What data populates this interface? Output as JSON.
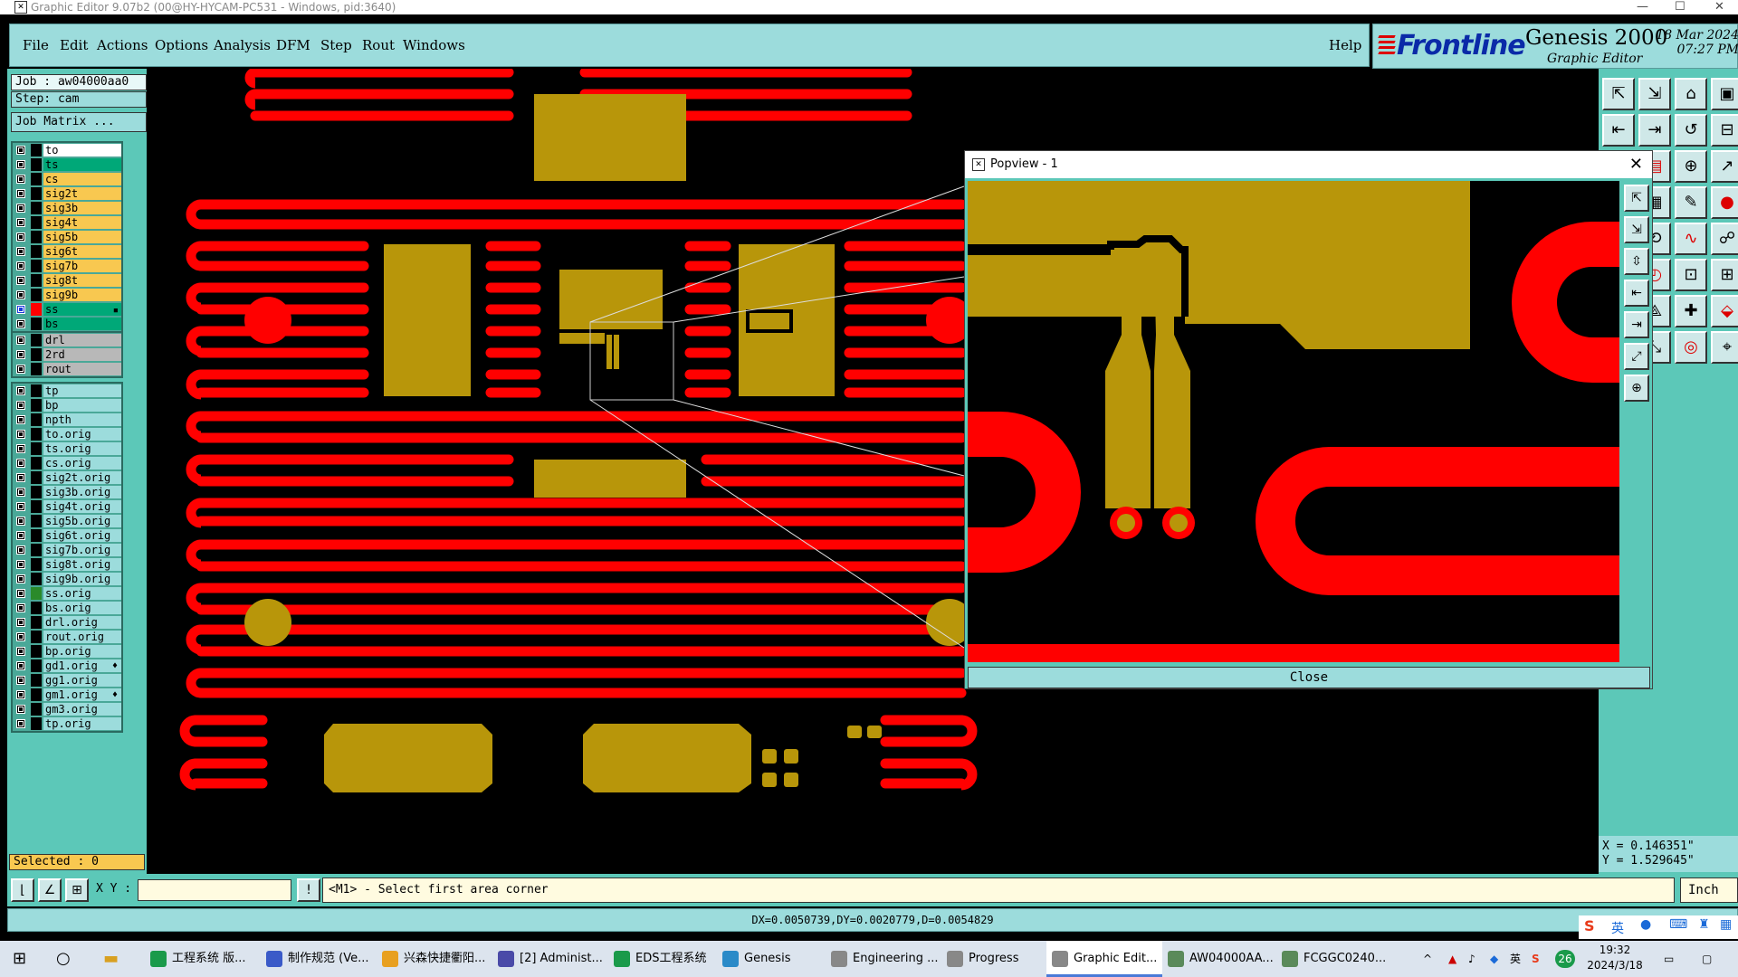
{
  "window": {
    "title": "Graphic Editor 9.07b2 (00@HY-HYCAM-PC531 - Windows, pid:3640)"
  },
  "menu": [
    "File",
    "Edit",
    "Actions",
    "Options",
    "Analysis",
    "DFM",
    "Step",
    "Rout",
    "Windows"
  ],
  "help": "Help",
  "brand": {
    "logo": "Frontline",
    "product": "Genesis 2000",
    "subtitle": "Graphic Editor",
    "date": "18 Mar 2024",
    "time": "07:27 PM"
  },
  "job": {
    "job": "Job : aw04000aa0",
    "step": "Step: cam",
    "matrix": "Job Matrix ..."
  },
  "layers_group1": [
    {
      "name": "to",
      "color": "#ffffff"
    },
    {
      "name": "ts",
      "color": "#00a878"
    },
    {
      "name": "cs",
      "color": "#f8c850"
    },
    {
      "name": "sig2t",
      "color": "#f8c850"
    },
    {
      "name": "sig3b",
      "color": "#f8c850"
    },
    {
      "name": "sig4t",
      "color": "#f8c850"
    },
    {
      "name": "sig5b",
      "color": "#f8c850"
    },
    {
      "name": "sig6t",
      "color": "#f8c850"
    },
    {
      "name": "sig7b",
      "color": "#f8c850"
    },
    {
      "name": "sig8t",
      "color": "#f8c850"
    },
    {
      "name": "sig9b",
      "color": "#f8c850"
    },
    {
      "name": "ss",
      "color": "#00a878",
      "active": true
    },
    {
      "name": "bs",
      "color": "#00a878"
    }
  ],
  "layers_group2": [
    {
      "name": "drl",
      "color": "#b8b8b8"
    },
    {
      "name": "2rd",
      "color": "#b8b8b8"
    },
    {
      "name": "rout",
      "color": "#b8b8b8"
    }
  ],
  "layers_group3": [
    {
      "name": "tp",
      "color": "#9cdcdc"
    },
    {
      "name": "bp",
      "color": "#9cdcdc"
    },
    {
      "name": "npth",
      "color": "#9cdcdc"
    },
    {
      "name": "to.orig",
      "color": "#9cdcdc"
    },
    {
      "name": "ts.orig",
      "color": "#9cdcdc"
    },
    {
      "name": "cs.orig",
      "color": "#9cdcdc"
    },
    {
      "name": "sig2t.orig",
      "color": "#9cdcdc"
    },
    {
      "name": "sig3b.orig",
      "color": "#9cdcdc"
    },
    {
      "name": "sig4t.orig",
      "color": "#9cdcdc"
    },
    {
      "name": "sig5b.orig",
      "color": "#9cdcdc"
    },
    {
      "name": "sig6t.orig",
      "color": "#9cdcdc"
    },
    {
      "name": "sig7b.orig",
      "color": "#9cdcdc"
    },
    {
      "name": "sig8t.orig",
      "color": "#9cdcdc"
    },
    {
      "name": "sig9b.orig",
      "color": "#9cdcdc"
    },
    {
      "name": "ss.orig",
      "color": "#9cdcdc",
      "swatch": "#2a8a2a"
    },
    {
      "name": "bs.orig",
      "color": "#9cdcdc"
    },
    {
      "name": "drl.orig",
      "color": "#9cdcdc"
    },
    {
      "name": "rout.orig",
      "color": "#9cdcdc"
    },
    {
      "name": "bp.orig",
      "color": "#9cdcdc"
    },
    {
      "name": "gd1.orig",
      "color": "#9cdcdc",
      "mark": "♦"
    },
    {
      "name": "gg1.orig",
      "color": "#9cdcdc"
    },
    {
      "name": "gm1.orig",
      "color": "#9cdcdc",
      "mark": "♦"
    },
    {
      "name": "gm3.orig",
      "color": "#9cdcdc"
    },
    {
      "name": "tp.orig",
      "color": "#9cdcdc"
    }
  ],
  "selected": "Selected : 0",
  "coords": {
    "x": "X = 0.146351\"",
    "y": "Y = 1.529645\""
  },
  "cmd": {
    "xy_label": "X Y :",
    "prompt": "<M1> - Select first area corner",
    "unit": "Inch"
  },
  "status": "DX=0.0050739,DY=0.0020779,D=0.0054829",
  "popview": {
    "title": "Popview - 1",
    "close": "Close"
  },
  "taskbar": [
    {
      "label": "工程系统  版...",
      "color": "#1a9a4a"
    },
    {
      "label": "制作规范 (Ve...",
      "color": "#3a5ac8"
    },
    {
      "label": "兴森快捷衢阳...",
      "color": "#e8a020"
    },
    {
      "label": "[2] Administ...",
      "color": "#4a4aa8"
    },
    {
      "label": "EDS工程系统",
      "color": "#1a9a4a"
    },
    {
      "label": "Genesis",
      "color": "#2a8ac8"
    },
    {
      "label": "Engineering ...",
      "color": "#888888"
    },
    {
      "label": "Progress",
      "color": "#888888"
    },
    {
      "label": "Graphic Edit...",
      "color": "#888888",
      "active": true
    },
    {
      "label": "AW04000AA...",
      "color": "#5a8a5a"
    },
    {
      "label": "FCGGC0240...",
      "color": "#5a8a5a"
    }
  ],
  "tray": {
    "lang": "英",
    "badge": "26",
    "time": "19:32",
    "date": "2024/3/18"
  },
  "colors": {
    "signal_red": "#ff0000",
    "pad_gold": "#b8960a",
    "panel": "#5cc8b8",
    "bar": "#9cdcdc"
  }
}
